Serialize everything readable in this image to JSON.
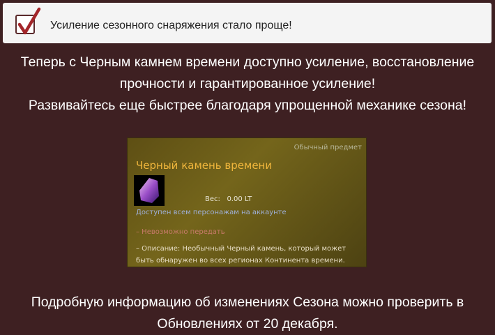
{
  "banner": {
    "title": "Усиление сезонного снаряжения стало проще!",
    "icon": "checkbox-checked-icon"
  },
  "intro": {
    "line1": "Теперь с Черным камнем времени доступно усиление, восстановление",
    "line2": "прочности и гарантированное усиление!",
    "line3": "Развивайтесь еще быстрее благодаря упрощенной механике сезона!"
  },
  "item": {
    "grade": "Обычный предмет",
    "name": "Черный камень времени",
    "weight_label": "Вес:",
    "weight_value": "0.00 LT",
    "account": "Доступен всем персонажам на аккаунте",
    "no_transfer": "– Невозможно передать",
    "description": "– Описание: Необычный Черный камень, который может быть обнаружен во всех регионах Континента времени."
  },
  "footer": {
    "line1": "Подробную информацию об изменениях Сезона можно проверить в",
    "line2": "Обновлениях от 20 декабря."
  }
}
